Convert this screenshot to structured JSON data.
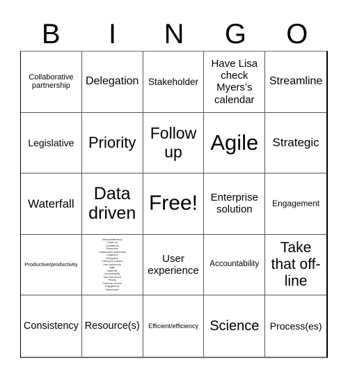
{
  "header": {
    "letters": [
      "B",
      "I",
      "N",
      "G",
      "O"
    ]
  },
  "board": {
    "rows": [
      [
        "Collaborative partnership",
        "Delegation",
        "Stakeholder",
        "Have Lisa check Myers’s calendar",
        "Streamline"
      ],
      [
        "Legislative",
        "Priority",
        "Follow up",
        "Agile",
        "Strategic"
      ],
      [
        "Waterfall",
        "Data driven",
        "Free!",
        "Enterprise solution",
        "Engagement"
      ],
      [
        "Productive/productivity",
        "",
        "User experience",
        "Accountability",
        "Take that off-line"
      ],
      [
        "Consistency",
        "Resource(s)",
        "Efficient/efficiency",
        "Science",
        "Process(es)"
      ]
    ],
    "tiny_cell_words": [
      "Efficient/efficiency",
      "Follow up",
      "Consistency",
      "Streamline",
      "Collaborative partnership",
      "Legislative",
      "Delegation",
      "Enterprise solution",
      "User experience",
      "Agile",
      "Waterfall",
      "Accountability",
      "Take that off-line",
      "Priority",
      "Customer service",
      "Engagement",
      "Stakeholder"
    ]
  }
}
